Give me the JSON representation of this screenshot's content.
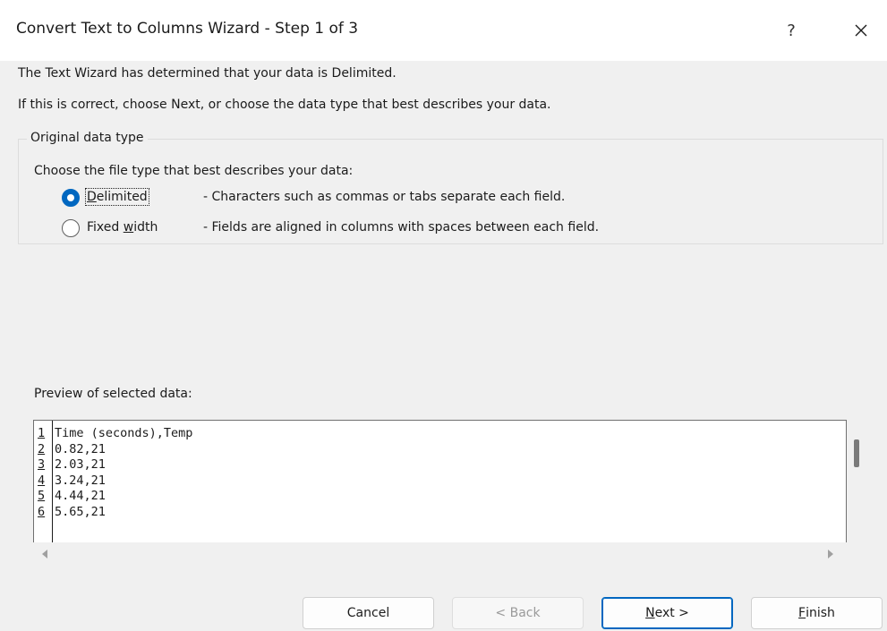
{
  "dialog": {
    "title": "Convert Text to Columns Wizard - Step 1 of 3",
    "help_label": "?",
    "intro_line1": "The Text Wizard has determined that your data is Delimited.",
    "intro_line2": "If this is correct, choose Next, or choose the data type that best describes your data."
  },
  "data_type": {
    "group_label": "Original data type",
    "prompt": "Choose the file type that best describes your data:",
    "options": [
      {
        "label_accel": "D",
        "label_rest": "elimited",
        "description": "- Characters such as commas or tabs separate each field.",
        "selected": true
      },
      {
        "label_pre": "Fixed ",
        "label_accel": "w",
        "label_rest": "idth",
        "description": "- Fields are aligned in columns with spaces between each field.",
        "selected": false
      }
    ]
  },
  "preview": {
    "label": "Preview of selected data:",
    "rows": [
      {
        "num": "1",
        "text": "Time (seconds),Temp"
      },
      {
        "num": "2",
        "text": "0.82,21"
      },
      {
        "num": "3",
        "text": "2.03,21"
      },
      {
        "num": "4",
        "text": "3.24,21"
      },
      {
        "num": "5",
        "text": "4.44,21"
      },
      {
        "num": "6",
        "text": "5.65,21"
      }
    ]
  },
  "buttons": {
    "cancel": "Cancel",
    "back": "< Back",
    "next_accel": "N",
    "next_rest": "ext >",
    "finish_accel": "F",
    "finish_rest": "inish"
  },
  "colors": {
    "accent": "#0067c0",
    "dialog_bg": "#f0f0f0",
    "title_bg": "#ffffff"
  },
  "icons": {
    "close": "close-icon",
    "scroll_left": "scroll-left-arrow-icon",
    "scroll_right": "scroll-right-arrow-icon"
  }
}
